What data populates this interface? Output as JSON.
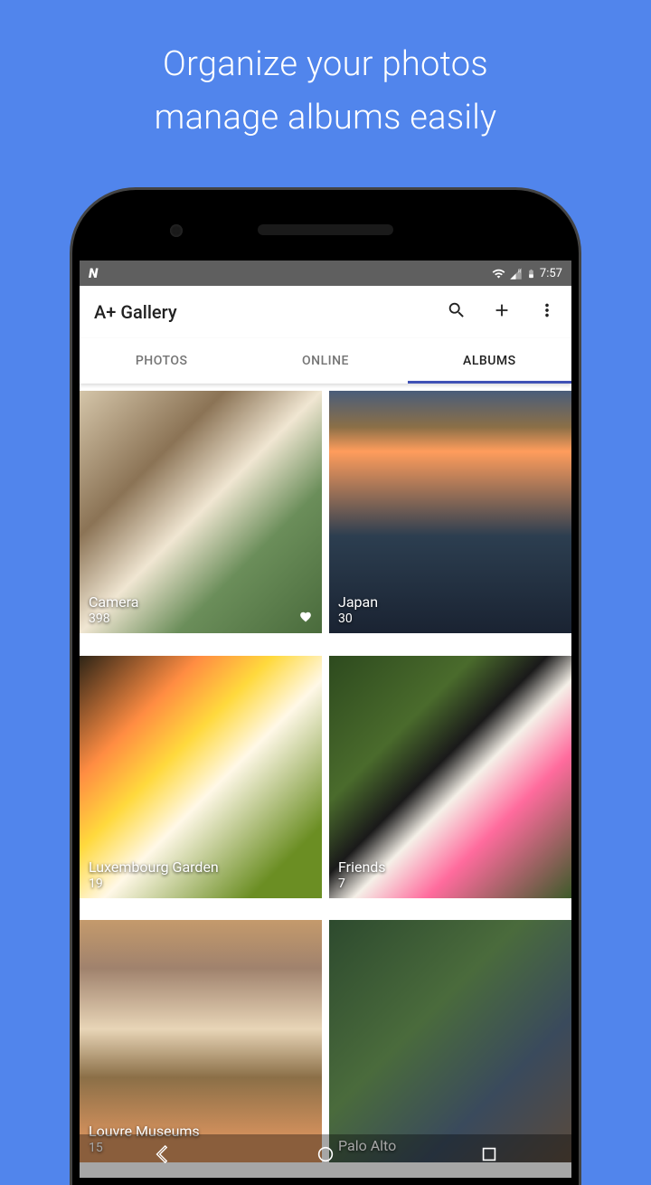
{
  "promo": {
    "line1": "Organize your photos",
    "line2": "manage albums easily"
  },
  "status": {
    "time": "7:57",
    "roaming": "R"
  },
  "toolbar": {
    "title": "A+ Gallery"
  },
  "tabs": [
    {
      "label": "PHOTOS",
      "active": false
    },
    {
      "label": "ONLINE",
      "active": false
    },
    {
      "label": "ALBUMS",
      "active": true
    }
  ],
  "albums": [
    {
      "name": "Camera",
      "count": "398",
      "imgClass": "img-camera",
      "favorite": true
    },
    {
      "name": "Japan",
      "count": "30",
      "imgClass": "img-japan",
      "favorite": false
    },
    {
      "name": "Luxembourg Garden",
      "count": "19",
      "imgClass": "img-luxembourg",
      "favorite": false
    },
    {
      "name": "Friends",
      "count": "7",
      "imgClass": "img-friends",
      "favorite": false
    },
    {
      "name": "Louvre Museums",
      "count": "15",
      "imgClass": "img-louvre",
      "favorite": false
    },
    {
      "name": "Palo Alto",
      "count": "",
      "imgClass": "img-paloalto",
      "favorite": false
    }
  ]
}
